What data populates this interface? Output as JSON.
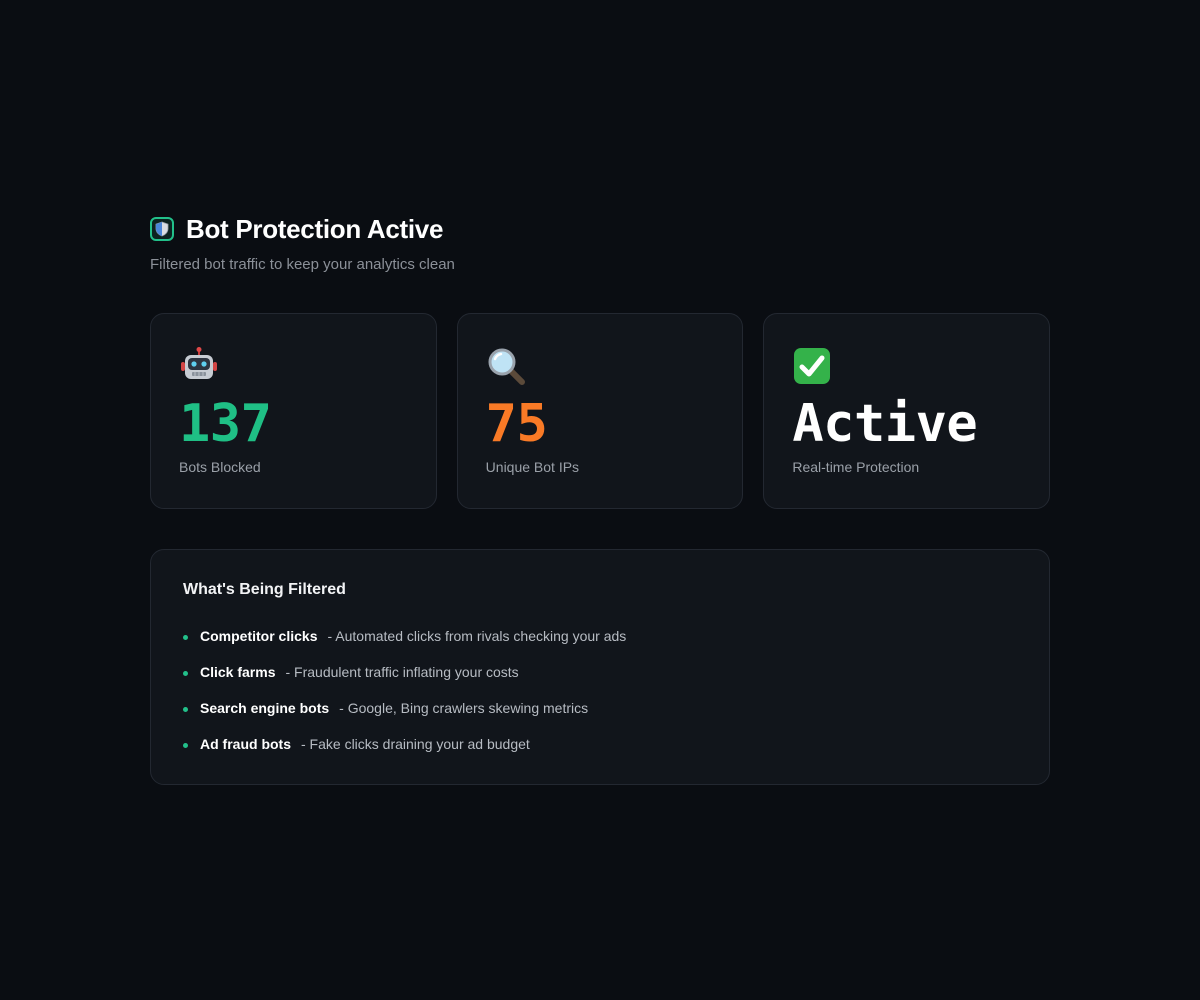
{
  "header": {
    "title": "Bot Protection Active",
    "subtitle": "Filtered bot traffic to keep your analytics clean",
    "icon": "shield-icon"
  },
  "stats": [
    {
      "icon": "robot-icon",
      "value": "137",
      "label": "Bots Blocked",
      "color": "#1fbf85"
    },
    {
      "icon": "magnifier-icon",
      "value": "75",
      "label": "Unique Bot IPs",
      "color": "#f97a26"
    },
    {
      "icon": "check-mark-icon",
      "value": "Active",
      "label": "Real-time Protection",
      "color": "#ffffff"
    }
  ],
  "filtered": {
    "title": "What's Being Filtered",
    "items": [
      {
        "name": "Competitor clicks",
        "description": "- Automated clicks from rivals checking your ads"
      },
      {
        "name": "Click farms",
        "description": "- Fraudulent traffic inflating your costs"
      },
      {
        "name": "Search engine bots",
        "description": "- Google, Bing crawlers skewing metrics"
      },
      {
        "name": "Ad fraud bots",
        "description": "- Fake clicks draining your ad budget"
      }
    ]
  },
  "colors": {
    "accent_green": "#22c08a",
    "background": "#0a0d12",
    "card": "#11151b"
  }
}
